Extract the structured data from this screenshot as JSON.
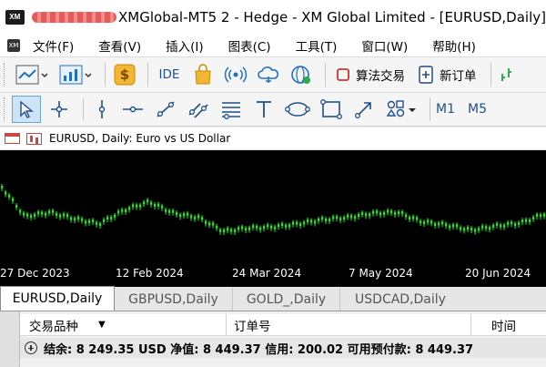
{
  "window": {
    "logo_text": "XM",
    "title": "XMGlobal-MT5 2 - Hedge - XM Global Limited - [EURUSD,Daily]"
  },
  "menu": {
    "items": [
      "文件(F)",
      "查看(V)",
      "插入(I)",
      "图表(C)",
      "工具(T)",
      "窗口(W)",
      "帮助(H)"
    ]
  },
  "toolbar": {
    "ide_label": "IDE",
    "algo_trading_label": "算法交易",
    "new_order_label": "新订单",
    "timeframes": [
      "M1",
      "M5"
    ]
  },
  "chart": {
    "header_title": "EURUSD, Daily:  Euro vs US Dollar",
    "x_tick_labels": [
      "27 Dec 2023",
      "12 Feb 2024",
      "24 Mar 2024",
      "7 May 2024",
      "20 Jun 2024"
    ],
    "background": "#000000",
    "candle_color": "#00ff00"
  },
  "chart_data": {
    "type": "line",
    "title": "EURUSD, Daily:  Euro vs US Dollar",
    "x": [
      "27 Dec 2023",
      "12 Feb 2024",
      "24 Mar 2024",
      "7 May 2024",
      "20 Jun 2024"
    ],
    "series": [
      {
        "values": [
          1.109,
          1.079,
          1.083,
          1.077,
          1.072,
          1.085,
          1.093,
          1.082,
          1.078,
          1.065,
          1.068,
          1.069,
          1.072,
          1.076,
          1.078,
          1.082,
          1.083,
          1.074,
          1.071,
          1.066,
          1.07,
          1.073,
          1.082
        ]
      }
    ],
    "xlabel": "",
    "ylabel": "",
    "grid": false
  },
  "tabs": [
    "EURUSD,Daily",
    "GBPUSD,Daily",
    "GOLD_,Daily",
    "USDCAD,Daily"
  ],
  "terminal": {
    "columns": [
      "交易品种",
      "订单号",
      "时间"
    ],
    "balance_text": "结余: 8 249.35 USD  净值: 8 449.37  信用: 200.02  可用预付款: 8 449.37"
  }
}
